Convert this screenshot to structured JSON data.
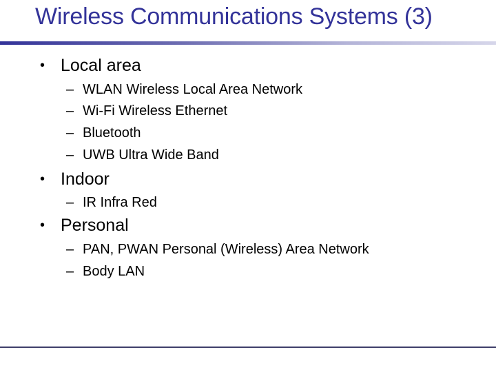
{
  "slide": {
    "title": "Wireless Communications Systems (3)",
    "title_color": "#333399",
    "rule_gradient": [
      "#333399",
      "#d6d6ea"
    ],
    "bottom_rule_color": "#3f3f6a",
    "bullet_glyph": "•",
    "dash_glyph": "–",
    "sections": [
      {
        "label": "Local area",
        "items": [
          "WLAN Wireless Local Area Network",
          "Wi-Fi Wireless Ethernet",
          "Bluetooth",
          "UWB Ultra Wide Band"
        ]
      },
      {
        "label": "Indoor",
        "items": [
          "IR Infra Red"
        ]
      },
      {
        "label": "Personal",
        "items": [
          "PAN, PWAN Personal (Wireless) Area Network",
          "Body LAN"
        ]
      }
    ]
  }
}
